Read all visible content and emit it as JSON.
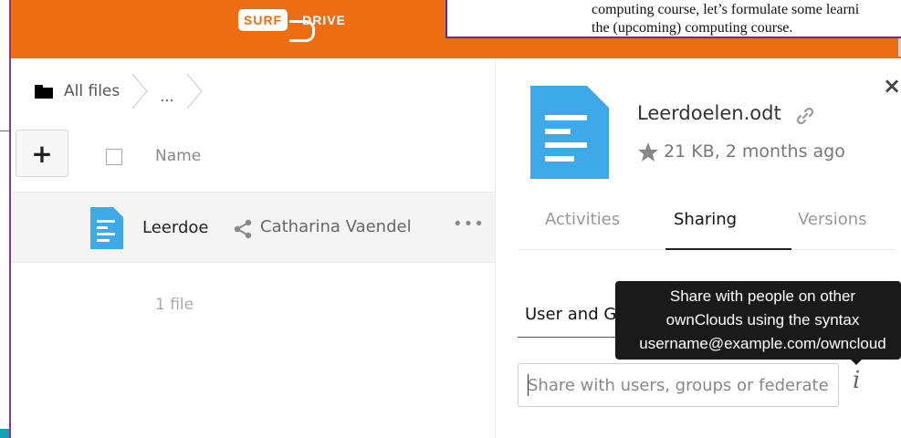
{
  "app": {
    "logo_left": "SURF",
    "logo_right": "DRIVE"
  },
  "breadcrumb": {
    "root": "All files",
    "ellipsis": "..."
  },
  "files": {
    "add_label": "+",
    "column_name": "Name",
    "rows": [
      {
        "name": "Leerdoe",
        "owner": "Catharina Vaendel",
        "more": "•••"
      }
    ],
    "count": "1 file"
  },
  "details": {
    "close_label": "×",
    "filename": "Leerdoelen.odt",
    "meta": "21 KB, 2 months ago",
    "tabs": [
      {
        "label": "Activities",
        "active": false
      },
      {
        "label": "Sharing",
        "active": true
      },
      {
        "label": "Versions",
        "active": false
      }
    ],
    "shares_header": "User and Groups",
    "share_placeholder": "Share with users, groups or federated",
    "info_label": "i",
    "tooltip_lines": [
      "Share with people on other",
      "ownClouds using the syntax",
      "username@example.com/owncloud"
    ]
  },
  "overlay": {
    "lines": [
      "computing course, let’s formulate some learni",
      "the (upcoming) computing course."
    ]
  },
  "colors": {
    "brand_orange": "#ec6d12",
    "file_blue": "#3ea9e8",
    "tooltip_bg": "#1a1a1a"
  }
}
